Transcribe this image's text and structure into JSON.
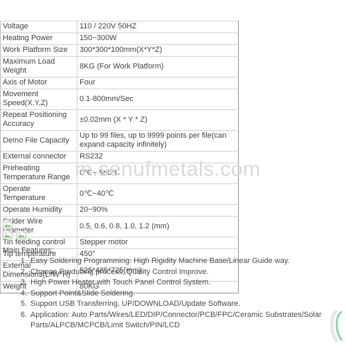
{
  "watermark": {
    "text": "m.senufmetals.com"
  },
  "spec_table": {
    "rows": [
      {
        "key": "Voltage",
        "value": "110 / 220V 50HZ"
      },
      {
        "key": "Heating Power",
        "value": "150~300W"
      },
      {
        "key": "Work Platform Size",
        "value": "300*300*100mm(X*Y*Z)"
      },
      {
        "key": "Maximum Load Weight",
        "value": "8KG (For Work Platform)"
      },
      {
        "key": "Axis of Motor",
        "value": "Four"
      },
      {
        "key": "Movement Speed(X,Y,Z)",
        "value": "0.1-800mm/Sec"
      },
      {
        "key": "Repeat Positioning Accuracy",
        "value": "±0.02mm (X * Y * Z)"
      },
      {
        "key": "Demo File Capacity",
        "value": "Up to 99 files, up to 9999 points per file(can expand capacity infinitely)"
      },
      {
        "key": "External connector",
        "value": "RS232"
      },
      {
        "key": "Preheating Temperature Range",
        "value": "0℃~ 550℃"
      },
      {
        "key": "Operate Temperature",
        "value": "0℃~40℃"
      },
      {
        "key": "Operate Humidity",
        "value": "20~90%"
      },
      {
        "key": "Solder Wire Diameter",
        "value": "0.5, 0.6, 0.8, 1.0, 1.2 (mm)"
      },
      {
        "key": "Tin feeding control",
        "value": "Stepper motor"
      },
      {
        "key": "Tip temperature",
        "value": "450°"
      },
      {
        "key": "External Dimensions(L*W*H)",
        "value": "525*485*725(mm)"
      },
      {
        "key": "Weight",
        "value": "80KG"
      }
    ]
  },
  "broken_images": {
    "row1": [
      "broken-image-icon"
    ],
    "row2": [
      "broken-image-icon",
      "broken-image-icon"
    ]
  },
  "features": {
    "title": "Main Features:",
    "items": [
      "Easy Soldering Programming: High Rigidity Machine Base/Linear Guide way.",
      "Change Producing process, Quality Control Improve.",
      "High Power Heater with Touch Panel Control System.",
      "Support Point&Slide Soldering.",
      "Support USB Transferring, UP/DOWNLOAD/Update Software.",
      "Application: Auto Parts/Wires/LED/DIP/Connector/PCB/FPC/Ceramic Substrates/Solar Parts/ALPCB/MCPCB/Limit Switch/PIN/LCD"
    ]
  },
  "colors": {
    "text": "#404040",
    "table_border": "#cfcfcf",
    "table_border_dark": "#8f8f8f",
    "watermark": "#d9d9d9",
    "logo_green": "#5ecb8a",
    "logo_gray": "#d2d2d2"
  }
}
